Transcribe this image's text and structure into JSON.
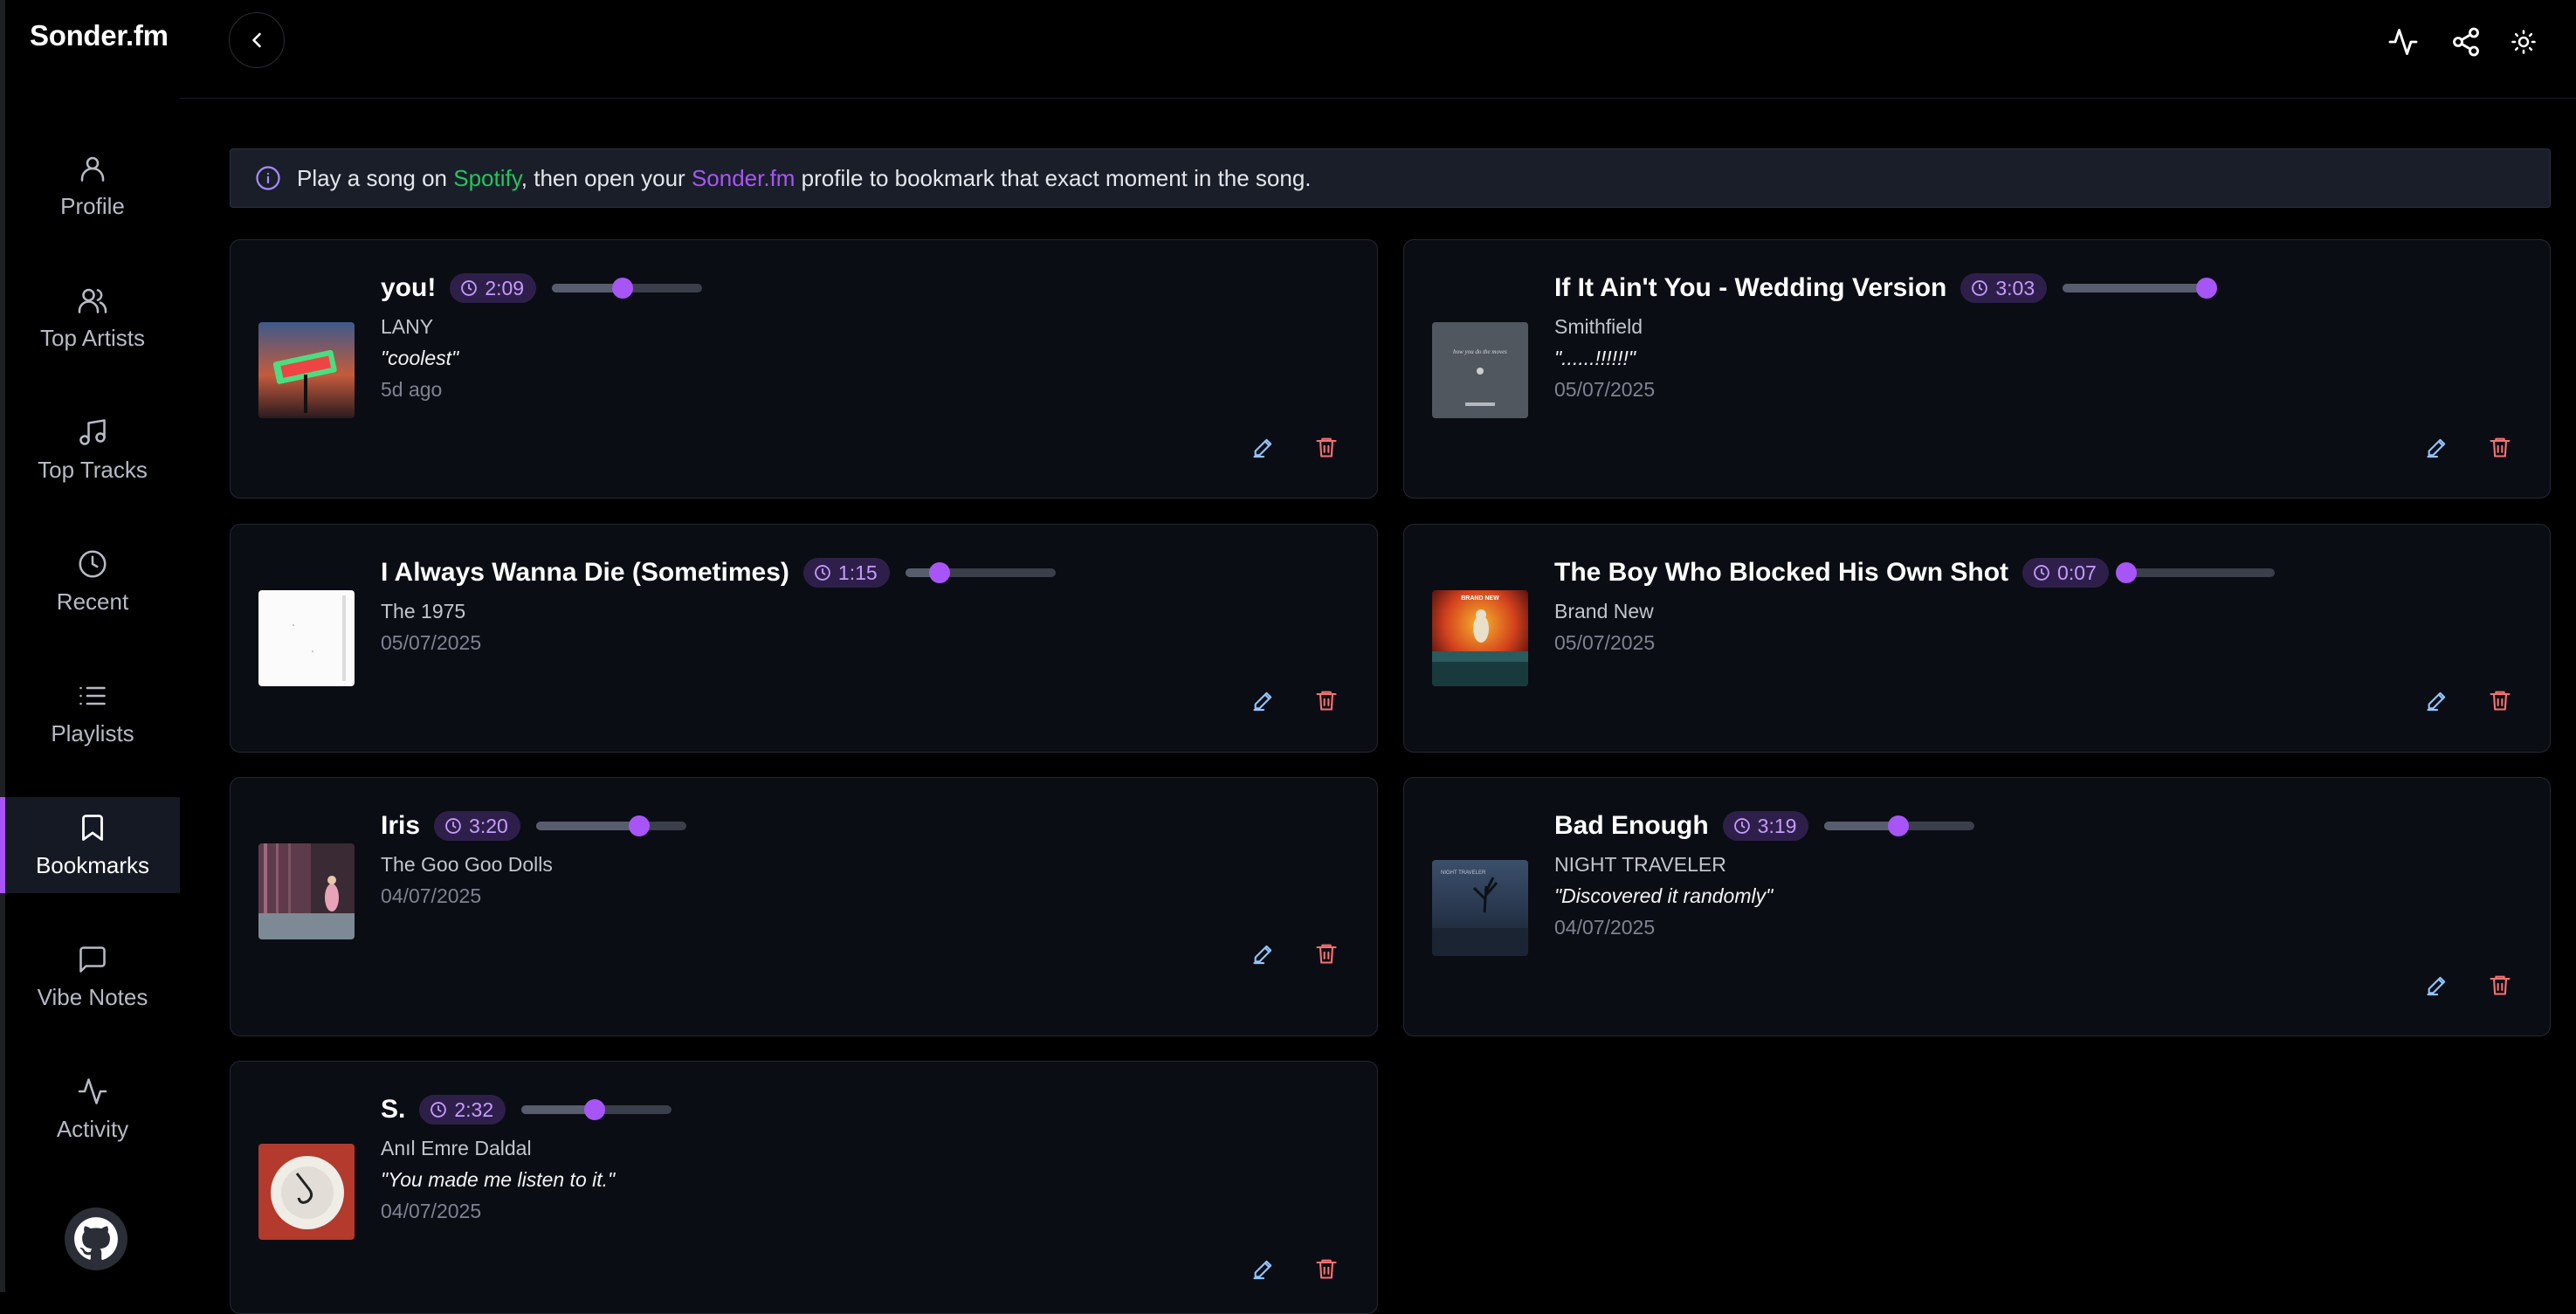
{
  "app": {
    "brand": "Sonder.fm"
  },
  "sidebar": {
    "items": [
      {
        "label": "Profile",
        "icon": "user-icon"
      },
      {
        "label": "Top Artists",
        "icon": "users-icon"
      },
      {
        "label": "Top Tracks",
        "icon": "music-note-icon"
      },
      {
        "label": "Recent",
        "icon": "clock-icon"
      },
      {
        "label": "Playlists",
        "icon": "list-icon"
      },
      {
        "label": "Bookmarks",
        "icon": "bookmark-icon",
        "active": true
      },
      {
        "label": "Vibe Notes",
        "icon": "message-icon"
      },
      {
        "label": "Activity",
        "icon": "activity-icon"
      }
    ],
    "footer_icon": "github-icon"
  },
  "header": {
    "back_icon": "chevron-left-icon",
    "right_icons": [
      "activity-icon",
      "share-icon",
      "sun-icon"
    ]
  },
  "banner": {
    "text_1": "Play a song on ",
    "spotify": "Spotify",
    "text_2": ", then open your ",
    "sonder": "Sonder.fm",
    "text_3": " profile to bookmark that exact moment in the song."
  },
  "bookmarks": [
    {
      "title": "you!",
      "time": "2:09",
      "progress": 0.47,
      "artist": "LANY",
      "note": "\"coolest\"",
      "date": "5d ago",
      "art": "album-art-you"
    },
    {
      "title": "If It Ain't You - Wedding Version",
      "time": "3:03",
      "progress": 0.96,
      "artist": "Smithfield",
      "note": "\"......!!!!!!\"",
      "date": "05/07/2025",
      "art": "album-art-smithfield"
    },
    {
      "title": "I Always Wanna Die (Sometimes)",
      "time": "1:15",
      "progress": 0.23,
      "artist": "The 1975",
      "note": "",
      "date": "05/07/2025",
      "art": "album-art-1975"
    },
    {
      "title": "The Boy Who Blocked His Own Shot",
      "time": "0:07",
      "progress": 0.01,
      "artist": "Brand New",
      "note": "",
      "date": "05/07/2025",
      "art": "album-art-brand-new"
    },
    {
      "title": "Iris",
      "time": "3:20",
      "progress": 0.69,
      "artist": "The Goo Goo Dolls",
      "note": "",
      "date": "04/07/2025",
      "art": "album-art-iris"
    },
    {
      "title": "Bad Enough",
      "time": "3:19",
      "progress": 0.49,
      "artist": "NIGHT TRAVELER",
      "note": "\"Discovered it randomly\"",
      "date": "04/07/2025",
      "art": "album-art-night-traveler"
    },
    {
      "title": "S.",
      "time": "2:32",
      "progress": 0.49,
      "artist": "Anıl Emre Daldal",
      "note": "\"You made me listen to it.\"",
      "date": "04/07/2025",
      "art": "album-art-s"
    }
  ],
  "colors": {
    "accent": "#a855f7",
    "spotify_green": "#22c55e",
    "delete_red": "#f87171",
    "edit_blue": "#93c5fd"
  }
}
